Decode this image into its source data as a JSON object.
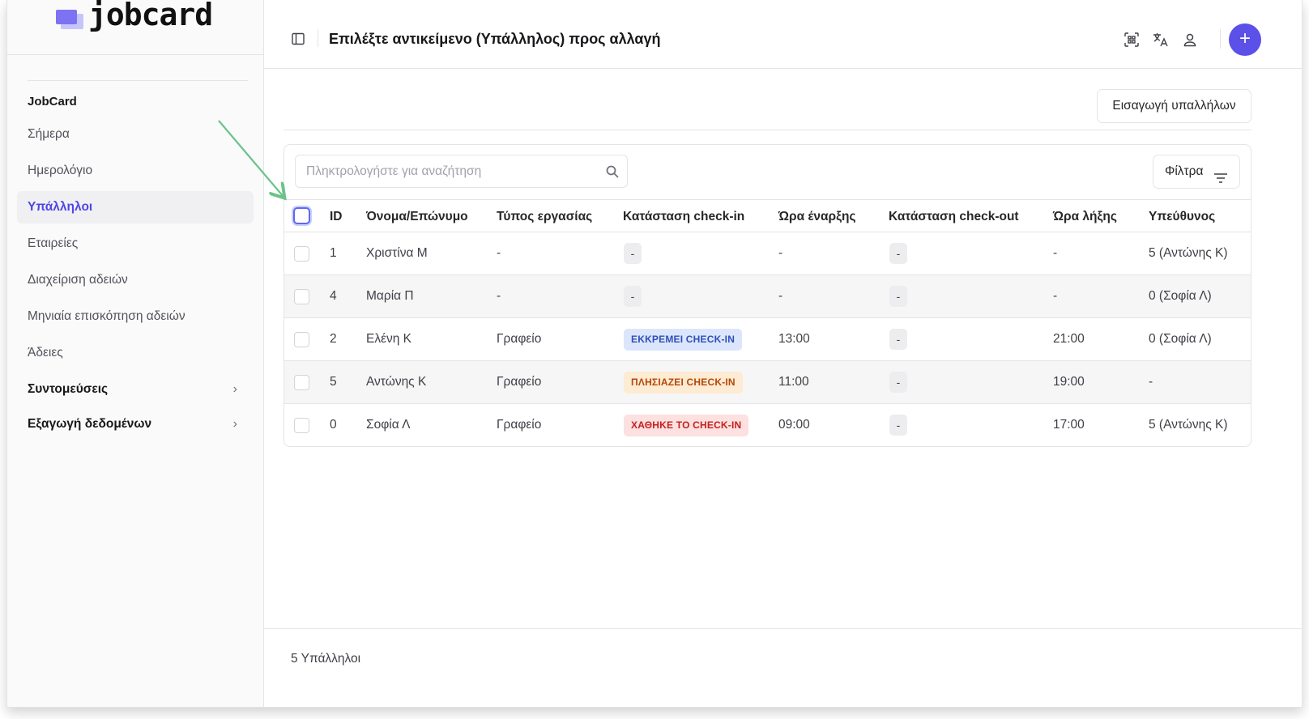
{
  "app": {
    "logo_text": "jobcard"
  },
  "sidebar": {
    "group_title": "JobCard",
    "items": [
      {
        "label": "Σήμερα",
        "active": false
      },
      {
        "label": "Ημερολόγιο",
        "active": false
      },
      {
        "label": "Υπάλληλοι",
        "active": true
      },
      {
        "label": "Εταιρείες",
        "active": false
      },
      {
        "label": "Διαχείριση αδειών",
        "active": false
      },
      {
        "label": "Μηνιαία επισκόπηση αδειών",
        "active": false
      },
      {
        "label": "Άδειες",
        "active": false
      }
    ],
    "sections": [
      {
        "label": "Συντομεύσεις",
        "icon": "chevron-right-icon"
      },
      {
        "label": "Εξαγωγή δεδομένων",
        "icon": "chevron-right-icon"
      }
    ]
  },
  "header": {
    "title": "Επιλέξτε αντικείμενο (Υπάλληλος) προς αλλαγή",
    "icons": [
      "qr-scan-icon",
      "translate-icon",
      "user-icon"
    ],
    "plus_label": "+",
    "accent": "#5b50e8"
  },
  "main": {
    "import_button": "Εισαγωγή υπαλλήλων",
    "search_placeholder": "Πληκτρολογήστε για αναζήτηση",
    "filters_button": "Φίλτρα",
    "columns": [
      "ID",
      "Όνομα/Επώνυμο",
      "Τύπος εργασίας",
      "Κατάσταση check-in",
      "Ώρα έναρξης",
      "Κατάσταση check-out",
      "Ώρα λήξης",
      "Υπεύθυνος"
    ],
    "rows": [
      {
        "id": "1",
        "name": "Χριστίνα Μ",
        "work_type": "-",
        "checkin_status": "-",
        "checkin_kind": "none",
        "start": "-",
        "checkout_status": "-",
        "end": "-",
        "manager": "5 (Αντώνης Κ)"
      },
      {
        "id": "4",
        "name": "Μαρία Π",
        "work_type": "-",
        "checkin_status": "-",
        "checkin_kind": "none",
        "start": "-",
        "checkout_status": "-",
        "end": "-",
        "manager": "0 (Σοφία Λ)"
      },
      {
        "id": "2",
        "name": "Ελένη Κ",
        "work_type": "Γραφείο",
        "checkin_status": "ΕΚΚΡΕΜΕΙ CHECK-IN",
        "checkin_kind": "pending",
        "start": "13:00",
        "checkout_status": "-",
        "end": "21:00",
        "manager": "0 (Σοφία Λ)"
      },
      {
        "id": "5",
        "name": "Αντώνης Κ",
        "work_type": "Γραφείο",
        "checkin_status": "ΠΛΗΣΙΑΖΕΙ CHECK-IN",
        "checkin_kind": "approaching",
        "start": "11:00",
        "checkout_status": "-",
        "end": "19:00",
        "manager": "-"
      },
      {
        "id": "0",
        "name": "Σοφία Λ",
        "work_type": "Γραφείο",
        "checkin_status": "ΧΑΘΗΚΕ ΤΟ CHECK-IN",
        "checkin_kind": "missed",
        "start": "09:00",
        "checkout_status": "-",
        "end": "17:00",
        "manager": "5 (Αντώνης Κ)"
      }
    ],
    "badge_colors": {
      "pending": {
        "bg": "#dbe6fd",
        "fg": "#2f4fb5"
      },
      "approaching": {
        "bg": "#fdebd3",
        "fg": "#b54708"
      },
      "missed": {
        "bg": "#fde0e0",
        "fg": "#c41f1f"
      }
    }
  },
  "footer": {
    "count_label": "5 Υπάλληλοι"
  },
  "annotation": {
    "arrow_color": "#6cc38a"
  }
}
